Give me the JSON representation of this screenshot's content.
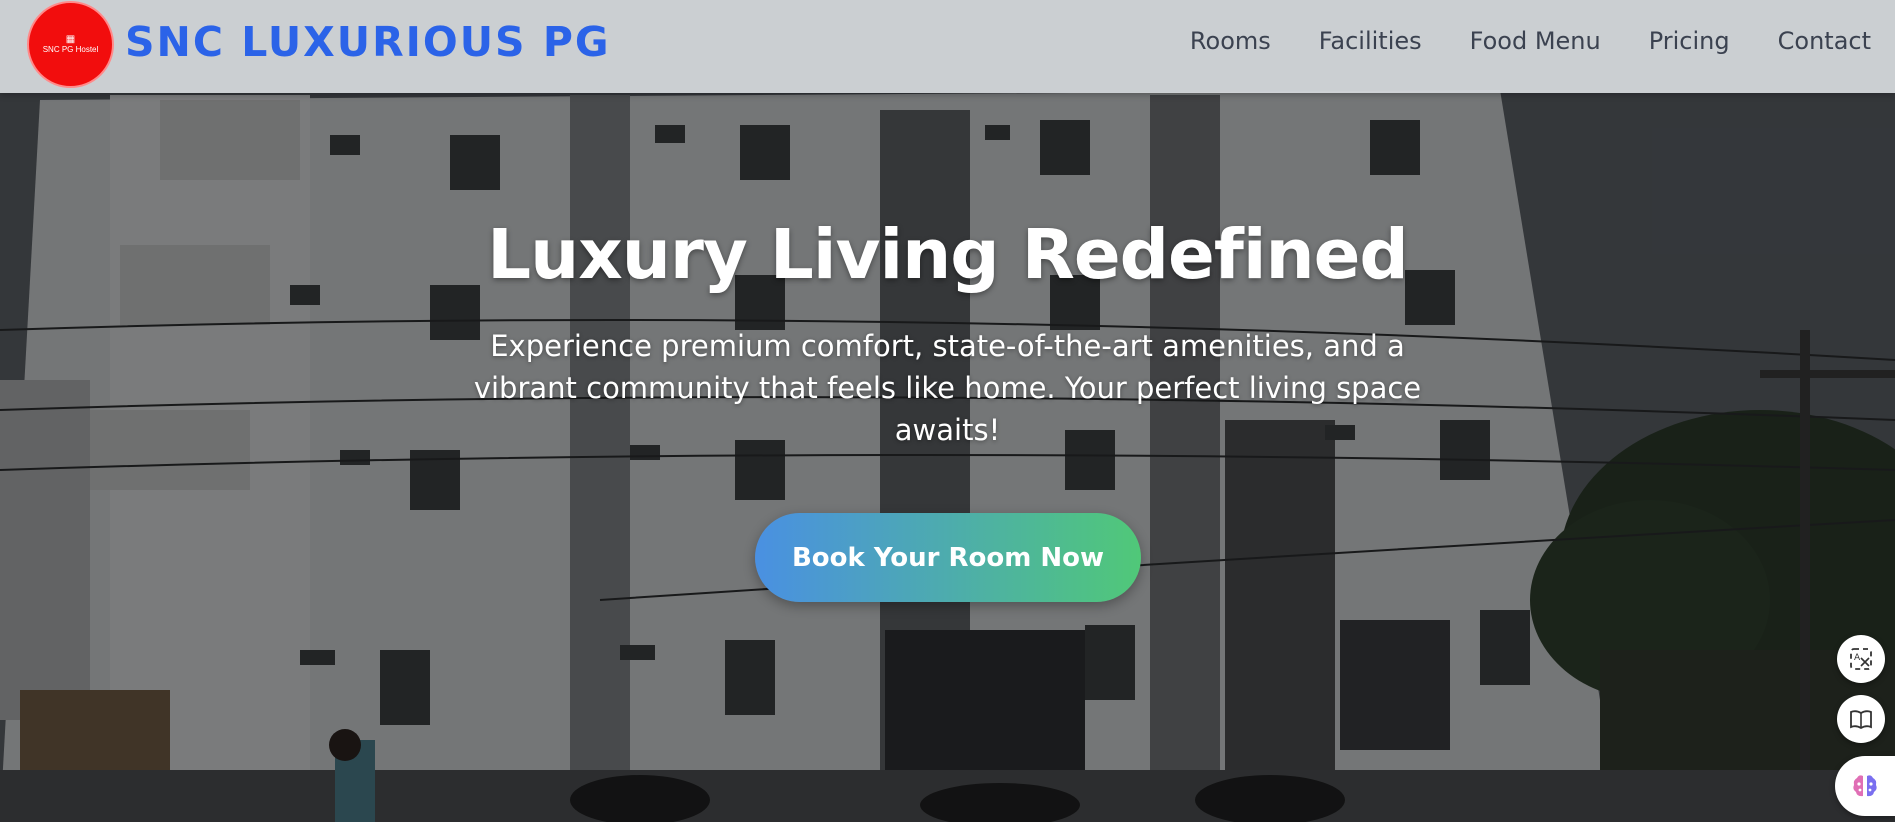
{
  "navbar": {
    "logo_text": "SNC PG Hostel",
    "brand": "SNC LUXURIOUS PG",
    "links": [
      "Rooms",
      "Facilities",
      "Food Menu",
      "Pricing",
      "Contact"
    ]
  },
  "hero": {
    "title": "Luxury Living Redefined",
    "subtitle": "Experience premium comfort, state-of-the-art amenities, and a vibrant community that feels like home. Your perfect living space awaits!",
    "cta_label": "Book Your Room Now"
  },
  "floating_buttons": [
    {
      "icon": "translate-icon"
    },
    {
      "icon": "book-icon"
    },
    {
      "icon": "ai-brain-icon"
    }
  ],
  "colors": {
    "brand": "#2b63e8",
    "logo_bg": "#f20d0d",
    "cta_gradient_start": "#4a90e2",
    "cta_gradient_end": "#50c878"
  }
}
